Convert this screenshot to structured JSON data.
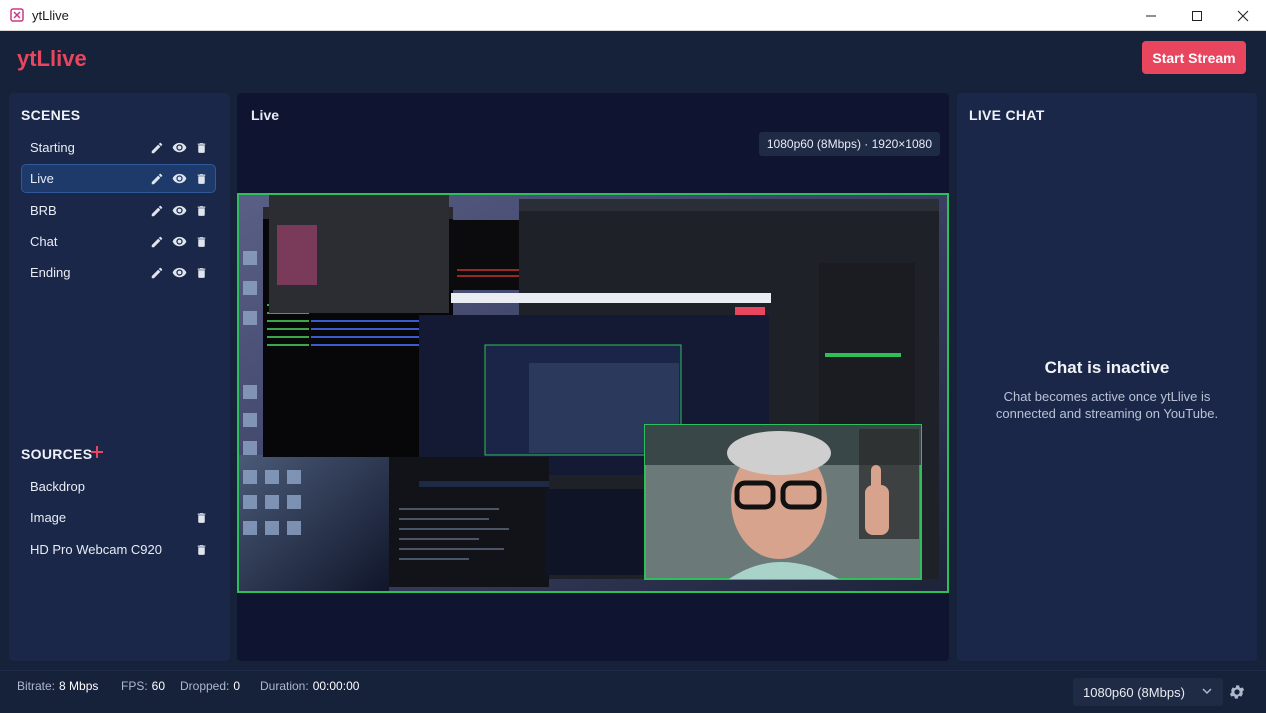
{
  "window": {
    "title": "ytLlive"
  },
  "header": {
    "brand": "ytLlive",
    "start_button": "Start Stream"
  },
  "scenes": {
    "title": "SCENES",
    "items": [
      {
        "label": "Starting",
        "active": false
      },
      {
        "label": "Live",
        "active": true
      },
      {
        "label": "BRB",
        "active": false
      },
      {
        "label": "Chat",
        "active": false
      },
      {
        "label": "Ending",
        "active": false
      }
    ]
  },
  "sources": {
    "title": "SOURCES",
    "items": [
      {
        "label": "Backdrop",
        "deletable": false
      },
      {
        "label": "Image",
        "deletable": true
      },
      {
        "label": "HD Pro Webcam C920",
        "deletable": true
      }
    ]
  },
  "preview": {
    "title": "Live",
    "resolution": "1080p60 (8Mbps) · 1920×1080"
  },
  "chat": {
    "title": "LIVE CHAT",
    "heading": "Chat is inactive",
    "message": "Chat becomes active once ytLlive is connected and streaming on YouTube."
  },
  "status": {
    "bitrate_label": "Bitrate:",
    "bitrate_value": "8  Mbps",
    "fps_label": "FPS:",
    "fps_value": "60",
    "dropped_label": "Dropped:",
    "dropped_value": "0",
    "duration_label": "Duration:",
    "duration_value": "00:00:00",
    "quality": "1080p60 (8Mbps)"
  },
  "colors": {
    "accent": "#e8455f",
    "preview_border": "#2fbf5a",
    "active_scene": "#1e3a6a"
  },
  "icons": {
    "edit": "pencil-icon",
    "visibility": "eye-icon",
    "delete": "trash-icon",
    "add": "plus-icon",
    "settings": "gear-icon"
  }
}
